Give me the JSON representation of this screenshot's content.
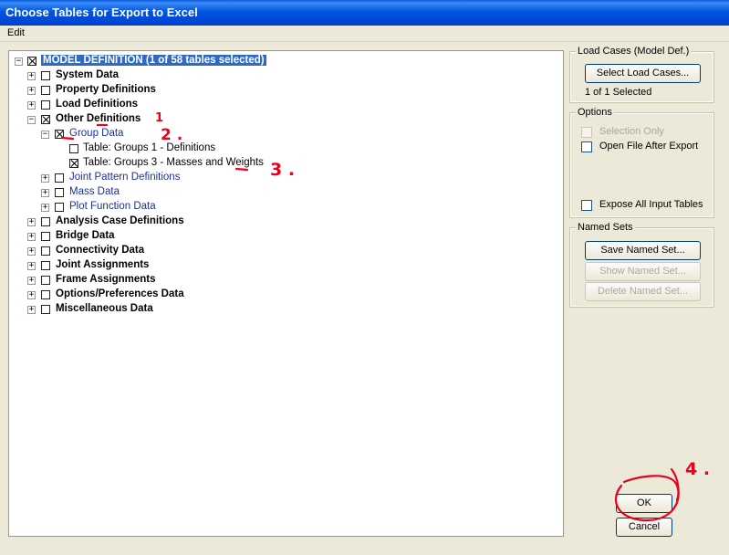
{
  "window": {
    "title": "Choose Tables for Export to Excel"
  },
  "menu": {
    "edit": "Edit"
  },
  "tree": {
    "root": {
      "label": "MODEL DEFINITION  (1 of 58 tables selected)"
    },
    "items": [
      {
        "label": "System Data"
      },
      {
        "label": "Property Definitions"
      },
      {
        "label": "Load Definitions"
      },
      {
        "label": "Other Definitions"
      },
      {
        "label": "Group Data"
      },
      {
        "label": "Table:  Groups 1 - Definitions"
      },
      {
        "label": "Table:  Groups 3 - Masses and Weights"
      },
      {
        "label": "Joint Pattern Definitions"
      },
      {
        "label": "Mass Data"
      },
      {
        "label": "Plot Function Data"
      },
      {
        "label": "Analysis Case Definitions"
      },
      {
        "label": "Bridge Data"
      },
      {
        "label": "Connectivity Data"
      },
      {
        "label": "Joint Assignments"
      },
      {
        "label": "Frame Assignments"
      },
      {
        "label": "Options/Preferences Data"
      },
      {
        "label": "Miscellaneous Data"
      }
    ]
  },
  "load_cases": {
    "caption": "Load Cases (Model Def.)",
    "button": "Select Load Cases...",
    "status": "1 of 1 Selected"
  },
  "options": {
    "caption": "Options",
    "selection_only": "Selection Only",
    "open_file": "Open File After Export",
    "expose_all": "Expose All Input Tables"
  },
  "named_sets": {
    "caption": "Named Sets",
    "save": "Save Named Set...",
    "show": "Show Named Set...",
    "delete": "Delete Named Set..."
  },
  "buttons": {
    "ok": "OK",
    "cancel": "Cancel"
  },
  "annotations": {
    "n1": "1",
    "n2": "2 .",
    "n3": "3 .",
    "n4": "4 ."
  }
}
